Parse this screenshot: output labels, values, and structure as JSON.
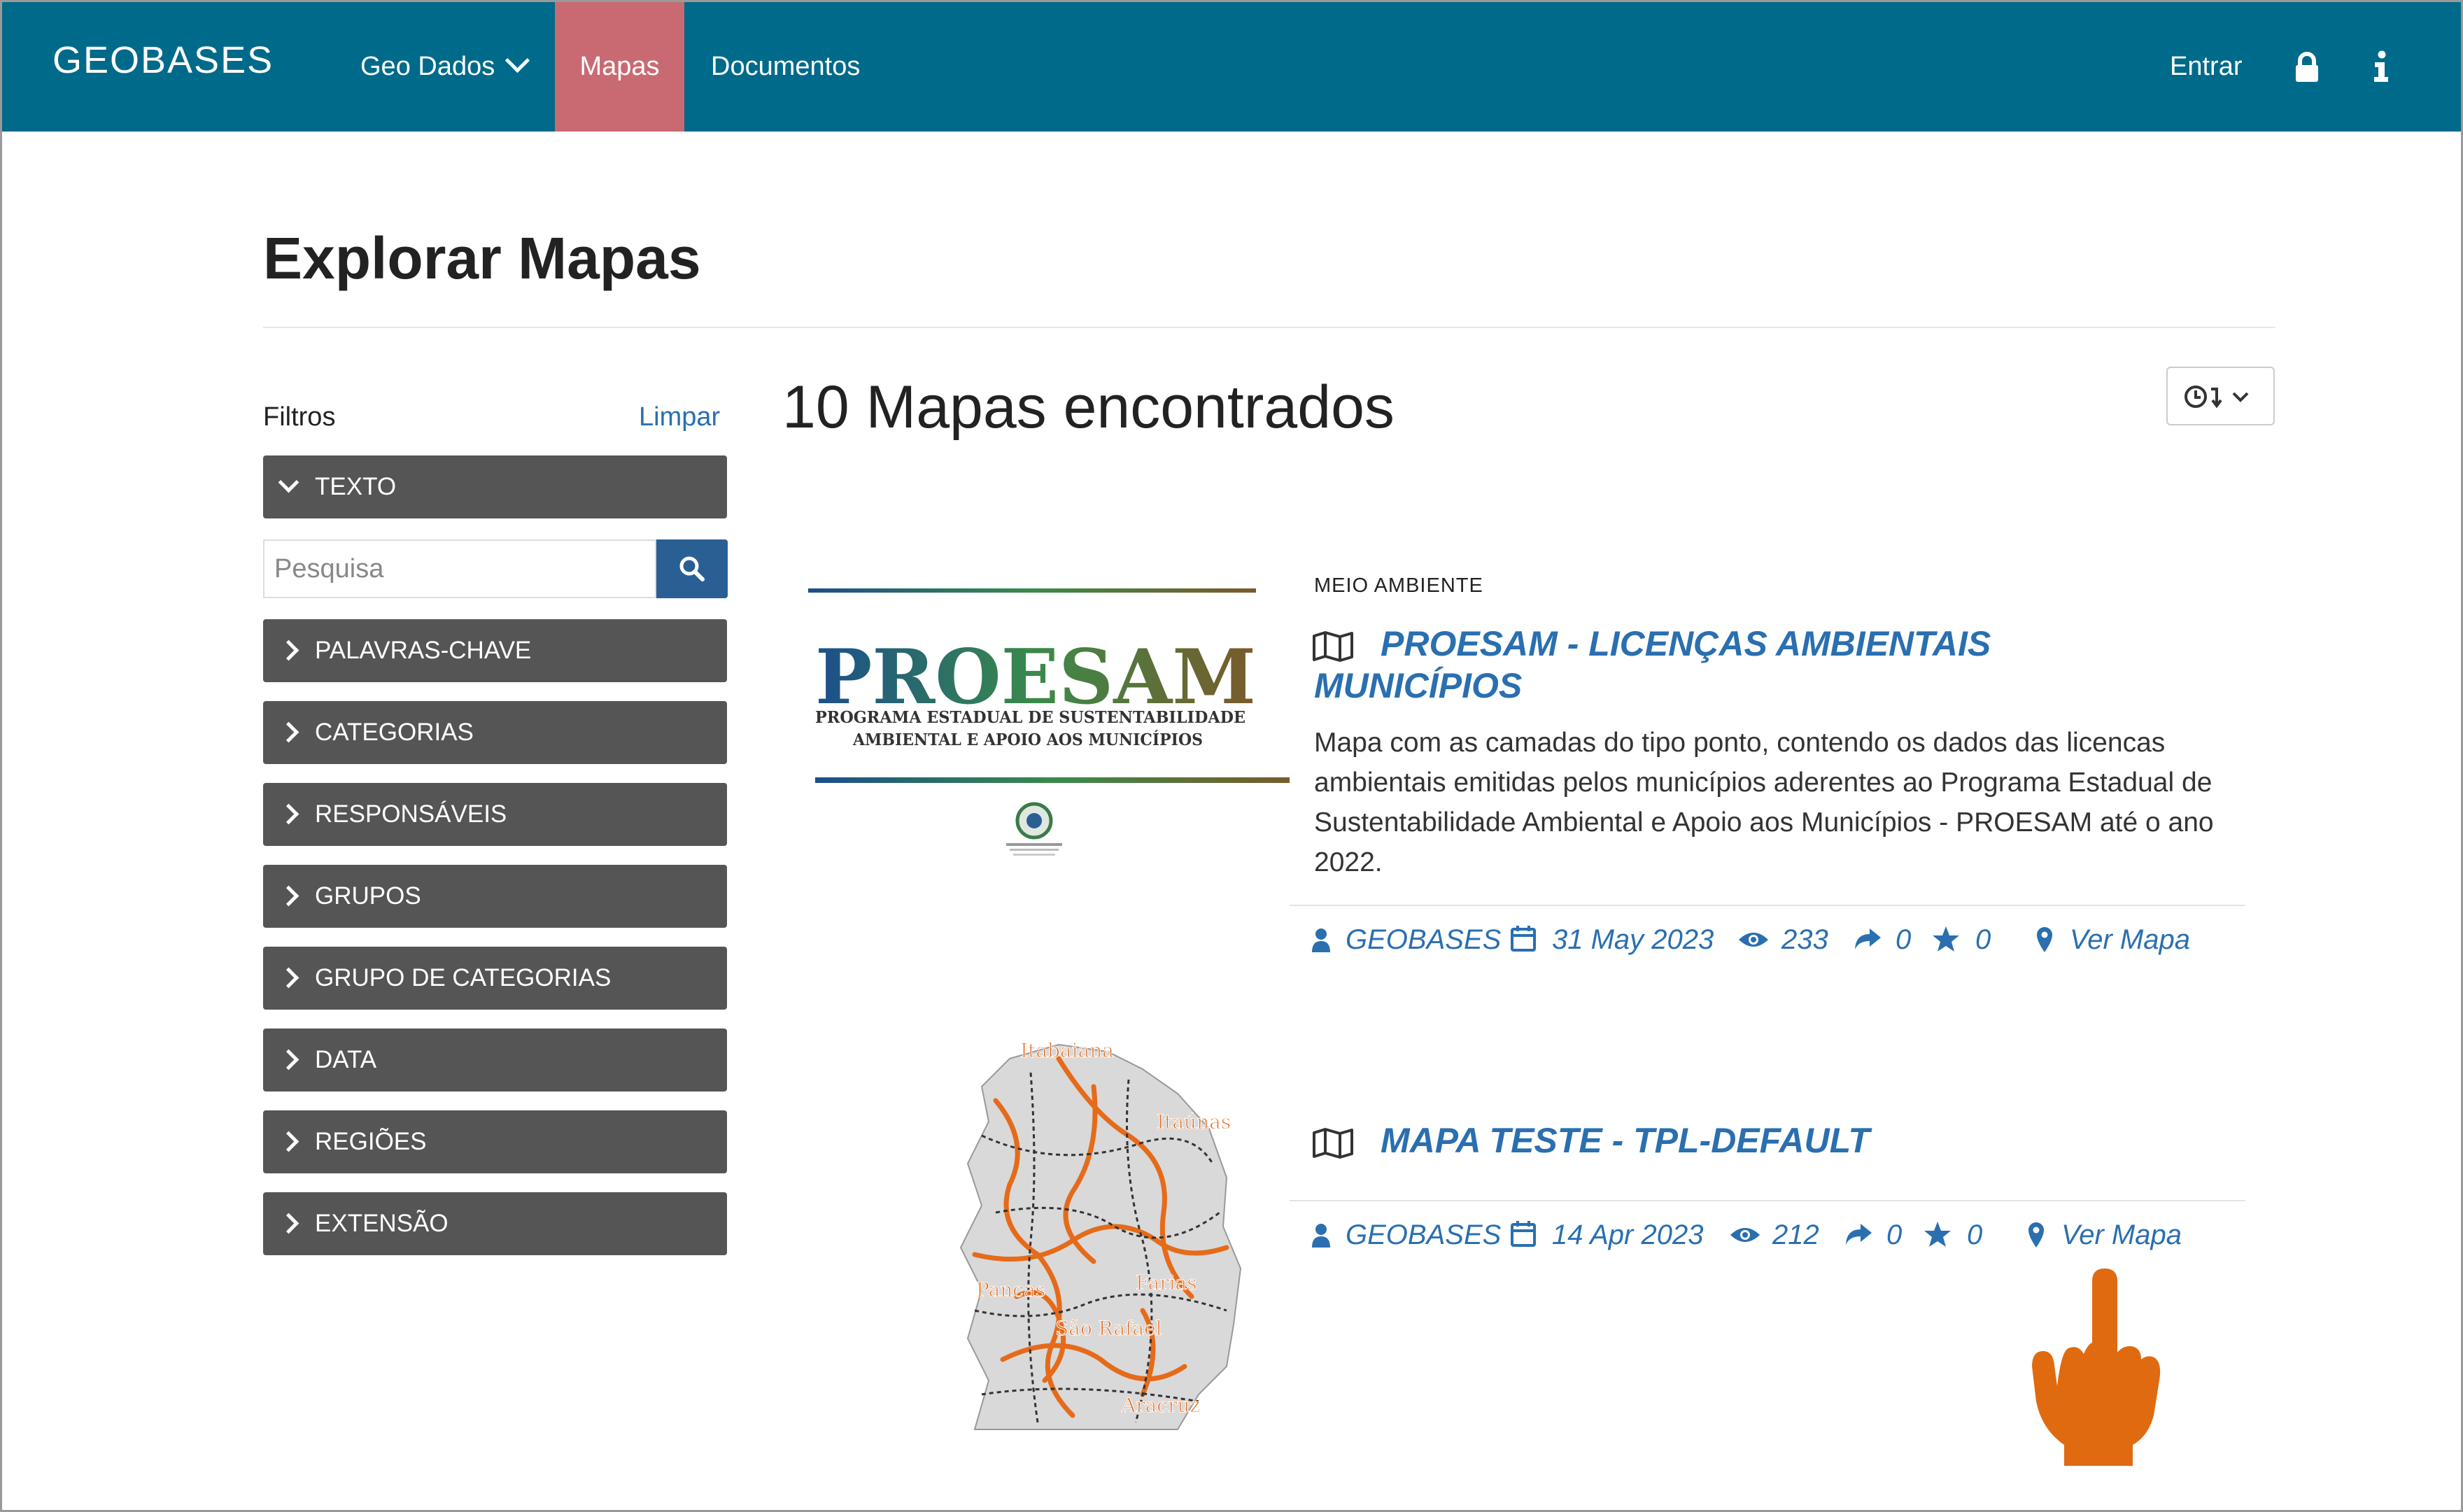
{
  "navbar": {
    "brand": "GEOBASES",
    "items": [
      {
        "label": "Geo Dados"
      },
      {
        "label": "Mapas",
        "active": true
      },
      {
        "label": "Documentos"
      }
    ],
    "login_label": "Entrar",
    "lock_icon": "lock-icon",
    "info_icon": "info-icon"
  },
  "page": {
    "title": "Explorar Mapas"
  },
  "filters": {
    "heading": "Filtros",
    "clear_label": "Limpar",
    "search_placeholder": "Pesquisa",
    "groups": [
      {
        "label": "TEXTO",
        "open": true
      },
      {
        "label": "PALAVRAS-CHAVE"
      },
      {
        "label": "CATEGORIAS"
      },
      {
        "label": "RESPONSÁVEIS"
      },
      {
        "label": "GRUPOS"
      },
      {
        "label": "GRUPO DE CATEGORIAS"
      },
      {
        "label": "DATA"
      },
      {
        "label": "REGIÕES"
      },
      {
        "label": "EXTENSÃO"
      }
    ]
  },
  "results": {
    "count_label": "10 Mapas encontrados",
    "sort_icon": "clock-sort-icon",
    "items": [
      {
        "category": "MEIO AMBIENTE",
        "title_line1": "PROESAM - LICENÇAS AMBIENTAIS",
        "title_line2": "MUNICÍPIOS",
        "description": "Mapa com as camadas do tipo ponto, contendo os dados das licencas ambientais emitidas pelos municípios aderentes ao Programa Estadual de Sustentabilidade Ambiental e Apoio aos Municípios - PROESAM até o ano 2022.",
        "thumbnail": {
          "logo_text": "PROESAM",
          "subtitle_line1": "PROGRAMA ESTADUAL DE SUSTENTABILIDADE",
          "subtitle_line2": "AMBIENTAL E APOIO AOS MUNICÍPIOS"
        },
        "owner": "GEOBASES",
        "date": "31 May 2023",
        "views": "233",
        "shares": "0",
        "stars": "0",
        "view_label": "Ver Mapa"
      },
      {
        "category": "",
        "title_line1": "MAPA TESTE - TPL-DEFAULT",
        "thumbnail": {
          "place_labels": [
            "Itabaiana",
            "Itaúnas",
            "Pancas",
            "Farias",
            "São Rafael",
            "Aracruz"
          ]
        },
        "owner": "GEOBASES",
        "date": "14 Apr 2023",
        "views": "212",
        "shares": "0",
        "stars": "0",
        "view_label": "Ver Mapa"
      }
    ]
  },
  "colors": {
    "navbar": "#006a8a",
    "active_tab": "#c96a72",
    "filter_bg": "#555555",
    "link": "#2a6fb0",
    "pointer_hand": "#e06a10"
  },
  "overlay_icon": "pointing-hand-icon"
}
